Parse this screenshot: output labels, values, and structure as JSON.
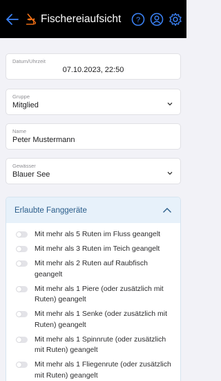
{
  "header": {
    "title": "Fischereiaufsicht",
    "back_icon": "arrow-left-icon",
    "logo_icon": "fishing-icon",
    "actions": [
      "help-icon",
      "account-icon",
      "settings-icon"
    ],
    "accent_color": "#3b82f6"
  },
  "form": {
    "datetime": {
      "label": "Datum/Uhrzeit",
      "value": "07.10.2023, 22:50"
    },
    "group": {
      "label": "Gruppe",
      "value": "Mitglied"
    },
    "name": {
      "label": "Name",
      "value": "Peter Mustermann"
    },
    "water": {
      "label": "Gewässer",
      "value": "Blauer See"
    }
  },
  "gear_section": {
    "title": "Erlaubte Fanggeräte",
    "expanded": true,
    "items": [
      {
        "label": "Mit mehr als 5 Ruten im Fluss geangelt",
        "checked": false
      },
      {
        "label": "Mit mehr als 3 Ruten im Teich geangelt",
        "checked": false
      },
      {
        "label": "Mit mehr als 2 Ruten auf Raubfisch geangelt",
        "checked": false
      },
      {
        "label": "Mit mehr als 1 Piere (oder zusätzlich mit Ruten) geangelt",
        "checked": false
      },
      {
        "label": "Mit mehr als 1 Senke (oder zusätzlich mit Ruten) geangelt",
        "checked": false
      },
      {
        "label": "Mit mehr als 1 Spinnrute (oder zusätzlich mit Ruten) geangelt",
        "checked": false
      },
      {
        "label": "Mit mehr als 1 Fliegenrute (oder zusätzlich mit Ruten) geangelt",
        "checked": false
      }
    ]
  }
}
